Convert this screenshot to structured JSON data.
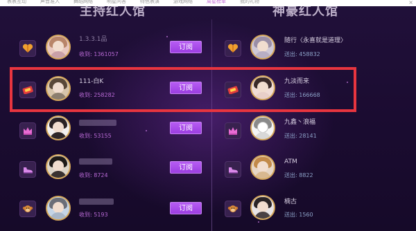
{
  "topnav": {
    "items": [
      "表表互动",
      "声音准入",
      "舞蹈网络",
      "明星问答",
      "特色表演",
      "游戏网络",
      "周星榜单",
      "我的礼物"
    ],
    "active_index": 6,
    "close_glyph": "×"
  },
  "left": {
    "title": "主持红人馆",
    "button_label": "订阅",
    "rows": [
      {
        "badge": "heart-icon",
        "name": "1.3.3.1品",
        "stat": "收到: 1361057"
      },
      {
        "badge": "ticket-icon",
        "name": "111-白K",
        "stat": "收到: 258282"
      },
      {
        "badge": "crown-icon",
        "name": "",
        "stat": "收到: 53155"
      },
      {
        "badge": "shoe-icon",
        "name": "",
        "stat": "收到: 8724"
      },
      {
        "badge": "monkey-icon",
        "name": "",
        "stat": "收到: 5193"
      }
    ]
  },
  "right": {
    "title": "神豪红人馆",
    "rows": [
      {
        "badge": "heart-icon",
        "name": "随行〈永喜就是道理〉",
        "stat": "送出: 458832"
      },
      {
        "badge": "ticket-icon",
        "name": "九淡而来",
        "stat": "送出: 166668"
      },
      {
        "badge": "crown-icon",
        "name": "九鑫丶浪福",
        "stat": "送出: 28141"
      },
      {
        "badge": "shoe-icon",
        "name": "ATM",
        "stat": "送出: 8822"
      },
      {
        "badge": "monkey-icon",
        "name": "楠古",
        "stat": "送出: 1560"
      }
    ]
  },
  "colors": {
    "accent": "#b75cf3",
    "highlight_border": "#e8353f",
    "avatar_ring": "#d4a65a"
  }
}
